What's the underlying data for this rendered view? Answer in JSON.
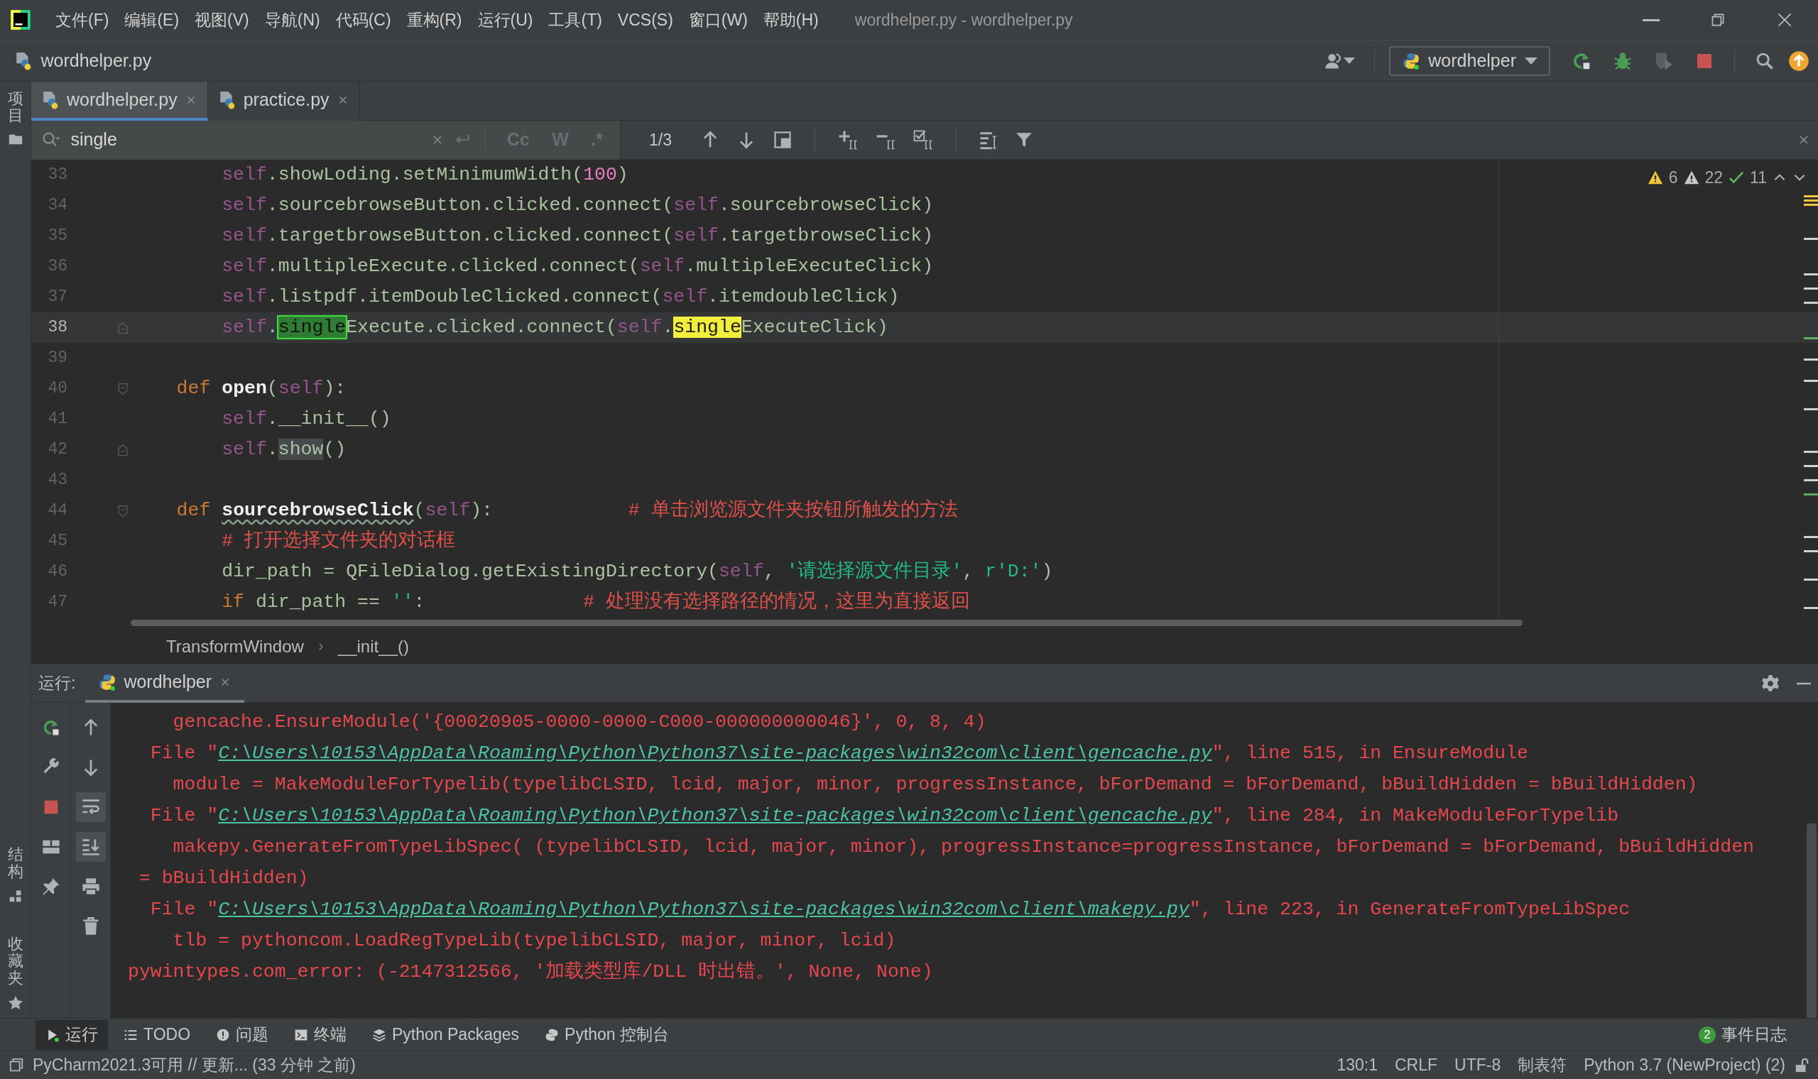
{
  "window": {
    "title": "wordhelper.py - wordhelper.py"
  },
  "menu": [
    "文件(F)",
    "编辑(E)",
    "视图(V)",
    "导航(N)",
    "代码(C)",
    "重构(R)",
    "运行(U)",
    "工具(T)",
    "VCS(S)",
    "窗口(W)",
    "帮助(H)"
  ],
  "project": {
    "name": "wordhelper.py"
  },
  "run_config": {
    "name": "wordhelper"
  },
  "left_strip": {
    "top": "项目",
    "bottom": [
      "结构",
      "收藏夹"
    ]
  },
  "editor_tabs": [
    {
      "label": "wordhelper.py",
      "selected": true
    },
    {
      "label": "practice.py",
      "selected": false
    }
  ],
  "find": {
    "value": "single",
    "count": "1/3",
    "options": [
      {
        "label": "Cc",
        "on": false
      },
      {
        "label": "W",
        "on": false
      },
      {
        "label": ".*",
        "on": false
      }
    ]
  },
  "inspections": {
    "warnings": "6",
    "weak_warnings": "22",
    "typos": "11"
  },
  "code_lines": [
    {
      "number": "33",
      "kind": "line",
      "current": false,
      "tokens": [
        {
          "kind": "self",
          "text": "        self"
        },
        {
          "kind": "plain",
          "text": ".showLoding.setMinimumWidth("
        },
        {
          "kind": "number",
          "text": "100"
        },
        {
          "kind": "plain",
          "text": ")"
        }
      ]
    },
    {
      "number": "34",
      "kind": "line",
      "current": false,
      "tokens": [
        {
          "kind": "self",
          "text": "        self"
        },
        {
          "kind": "plain",
          "text": ".sourcebrowseButton.clicked.connect("
        },
        {
          "kind": "self",
          "text": "self"
        },
        {
          "kind": "plain",
          "text": ".sourcebrowseClick)"
        }
      ]
    },
    {
      "number": "35",
      "kind": "line",
      "current": false,
      "tokens": [
        {
          "kind": "self",
          "text": "        self"
        },
        {
          "kind": "plain",
          "text": ".targetbrowseButton.clicked.connect("
        },
        {
          "kind": "self",
          "text": "self"
        },
        {
          "kind": "plain",
          "text": ".targetbrowseClick)"
        }
      ]
    },
    {
      "number": "36",
      "kind": "line",
      "current": false,
      "tokens": [
        {
          "kind": "self",
          "text": "        self"
        },
        {
          "kind": "plain",
          "text": ".multipleExecute.clicked.connect("
        },
        {
          "kind": "self",
          "text": "self"
        },
        {
          "kind": "plain",
          "text": ".multipleExecuteClick)"
        }
      ]
    },
    {
      "number": "37",
      "kind": "line",
      "current": false,
      "tokens": [
        {
          "kind": "self",
          "text": "        self"
        },
        {
          "kind": "plain",
          "text": ".listpdf.itemDoubleClicked.connect("
        },
        {
          "kind": "self",
          "text": "self"
        },
        {
          "kind": "plain",
          "text": ".itemdoubleClick)"
        }
      ]
    },
    {
      "number": "38",
      "kind": "fold_end",
      "current": true,
      "tokens": [
        {
          "kind": "self",
          "text": "        self"
        },
        {
          "kind": "plain",
          "text": "."
        },
        {
          "kind": "selected_match",
          "text": "single"
        },
        {
          "kind": "plain",
          "text": "Execute.clicked.connect("
        },
        {
          "kind": "self",
          "text": "self"
        },
        {
          "kind": "plain",
          "text": "."
        },
        {
          "kind": "match",
          "text": "single"
        },
        {
          "kind": "plain",
          "text": "ExecuteClick)"
        }
      ]
    },
    {
      "number": "39",
      "kind": "line",
      "current": false
    },
    {
      "number": "40",
      "kind": "fold_start",
      "current": false,
      "tokens": [
        {
          "kind": "keyword",
          "text": "    def "
        },
        {
          "kind": "name",
          "text": "open"
        },
        {
          "kind": "plain",
          "text": "("
        },
        {
          "kind": "self",
          "text": "self"
        },
        {
          "kind": "plain",
          "text": "):"
        }
      ]
    },
    {
      "number": "41",
      "kind": "line",
      "current": false,
      "tokens": [
        {
          "kind": "self",
          "text": "        self"
        },
        {
          "kind": "plain",
          "text": ".__init__()"
        }
      ]
    },
    {
      "number": "42",
      "kind": "fold_end",
      "current": false,
      "tokens": [
        {
          "kind": "self",
          "text": "        self"
        },
        {
          "kind": "plain",
          "text": "."
        },
        {
          "kind": "usage",
          "text": "show"
        },
        {
          "kind": "plain",
          "text": "()"
        }
      ]
    },
    {
      "number": "43",
      "kind": "line",
      "current": false
    },
    {
      "number": "44",
      "kind": "fold_start",
      "current": false,
      "tokens": [
        {
          "kind": "keyword",
          "text": "    def "
        },
        {
          "kind": "typo",
          "text": "sourcebrowseClick"
        },
        {
          "kind": "plain",
          "text": "("
        },
        {
          "kind": "self",
          "text": "self"
        },
        {
          "kind": "plain",
          "text": "):            "
        },
        {
          "kind": "comment",
          "text": "# 单击浏览源文件夹按钮所触发的方法"
        }
      ]
    },
    {
      "number": "45",
      "kind": "line",
      "current": false,
      "tokens": [
        {
          "kind": "comment",
          "text": "        # 打开选择文件夹的对话框"
        }
      ]
    },
    {
      "number": "46",
      "kind": "line",
      "current": false,
      "tokens": [
        {
          "kind": "plain",
          "text": "        dir_path = QFileDialog.getExistingDirectory("
        },
        {
          "kind": "self",
          "text": "self"
        },
        {
          "kind": "plain",
          "text": ", "
        },
        {
          "kind": "string",
          "text": "'请选择源文件目录'"
        },
        {
          "kind": "plain",
          "text": ", "
        },
        {
          "kind": "string",
          "text": "r'D:'"
        },
        {
          "kind": "plain",
          "text": ")"
        }
      ]
    },
    {
      "number": "47",
      "kind": "line",
      "current": false,
      "tokens": [
        {
          "kind": "keyword",
          "text": "        if"
        },
        {
          "kind": "plain",
          "text": " dir_path == "
        },
        {
          "kind": "string",
          "text": "''"
        },
        {
          "kind": "plain",
          "text": ":              "
        },
        {
          "kind": "comment",
          "text": "# 处理没有选择路径的情况，这里为直接返回"
        }
      ]
    }
  ],
  "breadcrumb": [
    "TransformWindow",
    "__init__()"
  ],
  "run_panel": {
    "label": "运行:",
    "tab": "wordhelper",
    "soft_wrap": true,
    "scroll_to_end": true,
    "output": [
      [
        {
          "kind": "text",
          "text": "    gencache.EnsureModule('{00020905-0000-0000-C000-000000000046}', 0, 8, 4)"
        }
      ],
      [
        {
          "kind": "text",
          "text": "  File \""
        },
        {
          "kind": "link",
          "text": "C:\\Users\\10153\\AppData\\Roaming\\Python\\Python37\\site-packages\\win32com\\client\\gencache.py"
        },
        {
          "kind": "text",
          "text": "\", line 515, in EnsureModule"
        }
      ],
      [
        {
          "kind": "text",
          "text": "    module = MakeModuleForTypelib(typelibCLSID, lcid, major, minor, progressInstance, bForDemand = bForDemand, bBuildHidden = bBuildHidden)"
        }
      ],
      [
        {
          "kind": "text",
          "text": "  File \""
        },
        {
          "kind": "link",
          "text": "C:\\Users\\10153\\AppData\\Roaming\\Python\\Python37\\site-packages\\win32com\\client\\gencache.py"
        },
        {
          "kind": "text",
          "text": "\", line 284, in MakeModuleForTypelib"
        }
      ],
      [
        {
          "kind": "text",
          "text": "    makepy.GenerateFromTypeLibSpec( (typelibCLSID, lcid, major, minor), progressInstance=progressInstance, bForDemand = bForDemand, bBuildHidden"
        }
      ],
      [
        {
          "kind": "text",
          "text": " = bBuildHidden)"
        }
      ],
      [
        {
          "kind": "text",
          "text": "  File \""
        },
        {
          "kind": "link",
          "text": "C:\\Users\\10153\\AppData\\Roaming\\Python\\Python37\\site-packages\\win32com\\client\\makepy.py"
        },
        {
          "kind": "text",
          "text": "\", line 223, in GenerateFromTypeLibSpec"
        }
      ],
      [
        {
          "kind": "text",
          "text": "    tlb = pythoncom.LoadRegTypeLib(typelibCLSID, major, minor, lcid)"
        }
      ],
      [
        {
          "kind": "text",
          "text": "pywintypes.com_error: (-2147312566, '加载类型库/DLL 时出错。', None, None)"
        }
      ]
    ]
  },
  "tool_tabs": [
    {
      "kind": "run",
      "label": "运行",
      "selected": true
    },
    {
      "kind": "todo",
      "label": "TODO",
      "selected": false
    },
    {
      "kind": "problems",
      "label": "问题",
      "selected": false
    },
    {
      "kind": "terminal",
      "label": "终端",
      "selected": false
    },
    {
      "kind": "packages",
      "label": "Python Packages",
      "selected": false
    },
    {
      "kind": "console",
      "label": "Python 控制台",
      "selected": false
    }
  ],
  "event_log": {
    "count": "2",
    "label": "事件日志"
  },
  "status_bar": {
    "message": "PyCharm2021.3可用 // 更新... (33 分钟 之前)",
    "items": [
      "130:1",
      "CRLF",
      "UTF-8",
      "制表符",
      "Python 3.7 (NewProject) (2)"
    ]
  }
}
